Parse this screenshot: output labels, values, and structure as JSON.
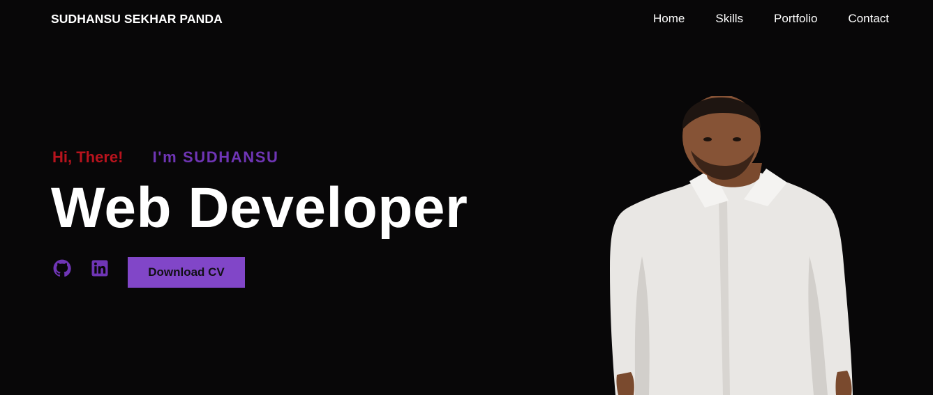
{
  "header": {
    "brand": "SUDHANSU SEKHAR PANDA",
    "nav": [
      "Home",
      "Skills",
      "Portfolio",
      "Contact"
    ]
  },
  "hero": {
    "greeting": "Hi, There!",
    "intro": "I'm SUDHANSU",
    "title": "Web Developer",
    "cta_label": "Download CV"
  },
  "icons": {
    "github": "github-icon",
    "linkedin": "linkedin-icon"
  },
  "colors": {
    "background": "#080708",
    "greeting": "#b8131d",
    "accent": "#6f35b5",
    "button": "#8146c8",
    "text": "#ffffff"
  }
}
